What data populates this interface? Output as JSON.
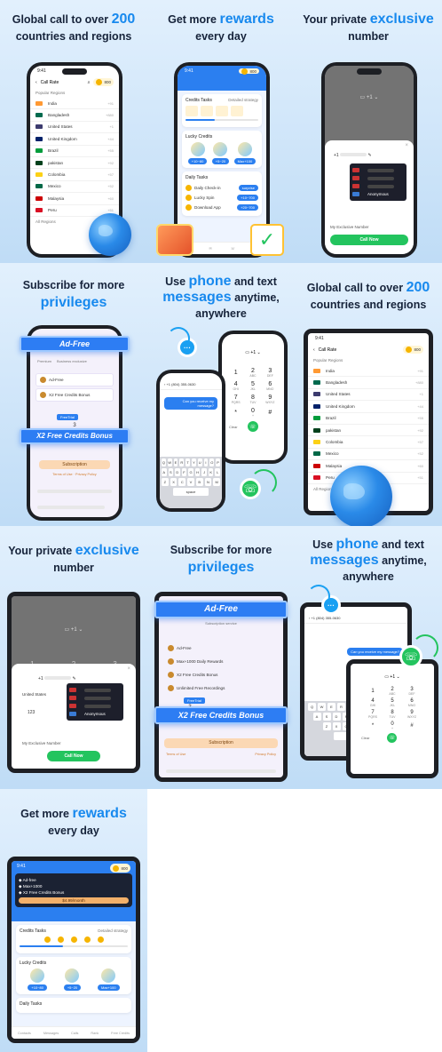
{
  "screens": [
    {
      "head_pre": "Global call to over ",
      "head_hl": "200",
      "head_post": "countries and regions"
    },
    {
      "head_pre": "Get more ",
      "head_hl": "rewards",
      "head_post": "every day"
    },
    {
      "head_pre": "Your private ",
      "head_hl": "exclusive",
      "head_post": "number"
    },
    {
      "head_pre": "Subscribe for more",
      "head_hl": "privileges",
      "head_post": ""
    },
    {
      "head_pre": "Use ",
      "head_hl": "phone",
      "head_mid": " and text",
      "head_hl2": "messages",
      "head_mid2": " anytime,",
      "head_post": "anywhere"
    },
    {
      "head_pre": "Global call to over ",
      "head_hl": "200",
      "head_post": "countries and regions"
    },
    {
      "head_pre": "Your private ",
      "head_hl": "exclusive",
      "head_post": "number"
    },
    {
      "head_pre": "Subscribe for more",
      "head_hl": "privileges",
      "head_post": ""
    },
    {
      "head_pre": "Use ",
      "head_hl": "phone",
      "head_mid": " and text",
      "head_hl2": "messages",
      "head_mid2": " anytime,",
      "head_post": "anywhere"
    },
    {
      "head_pre": "Get more ",
      "head_hl": "rewards",
      "head_post": "every day"
    }
  ],
  "status": {
    "time": "9:41",
    "credits": "800"
  },
  "call_rate": {
    "title": "Call Rate",
    "section": "Popular Regions",
    "all": "All Regions",
    "countries": [
      "India",
      "Bangladesh",
      "United States",
      "United Kingdom",
      "Brazil",
      "pakistan",
      "Colombia",
      "Mexico",
      "Malaysia",
      "Peru"
    ],
    "flags": [
      "#ff9933",
      "#006a4e",
      "#3c3b6e",
      "#012169",
      "#009c3b",
      "#01411c",
      "#fcd116",
      "#006847",
      "#cc0001",
      "#d91023"
    ],
    "rates": [
      "+91",
      "+880",
      "+1",
      "+44",
      "+55",
      "+92",
      "+57",
      "+52",
      "+60",
      "+51"
    ]
  },
  "rewards": {
    "credits_tasks": "Credits Tasks",
    "lucky_credits": "Lucky Credits",
    "daily_tasks": "Daily Tasks",
    "lucky": [
      "+10~80",
      "+5~20",
      "Max+100"
    ],
    "tasks": [
      "Daily Check-in",
      "Lucky Spin",
      "Download App"
    ],
    "task_btns": [
      "surprise",
      "+10~700",
      "+20~700"
    ],
    "rule": "Detailed strategy",
    "plan": [
      "Ad-free",
      "Max+1000",
      "X2 Free Credits Bonus"
    ],
    "price": "$4.99/month",
    "nav": [
      "Contacts",
      "Messages",
      "Calls",
      "Rank",
      "Free Credits"
    ]
  },
  "exclusive": {
    "code": "+1",
    "country": "United States",
    "label": "My Exclusive Number",
    "call": "Call Now",
    "anon": "Anonymous",
    "area": "123"
  },
  "subscribe": {
    "banner1": "Ad-Free",
    "banner2": "X2 Free Credits Bonus",
    "banner3": "Max+1000 Daily Rewards",
    "row1": "Ad-Free",
    "row2": "X2 Free Credits Bonus",
    "row3": "Max+1000 Daily Rewards",
    "row4": "Unlimited Free Recordings",
    "tab1": "Premium",
    "tab2": "Business exclusive",
    "trial": "FreeTrial",
    "num": "3",
    "btn": "Subscription",
    "terms": "Terms of Use",
    "privacy": "Privacy Policy",
    "sub_title": "Subscription service"
  },
  "messages": {
    "code": "+1",
    "msg_in": "Can you receive my message?",
    "msg_out": "Can you receive my message?",
    "number": "+1 (804) 355-0630",
    "keys": [
      "1",
      "2",
      "3",
      "4",
      "5",
      "6",
      "7",
      "8",
      "9",
      "*",
      "0",
      "#"
    ],
    "key_letters": [
      "",
      "ABC",
      "DEF",
      "GHI",
      "JKL",
      "MNO",
      "PQRS",
      "TUV",
      "WXYZ",
      "",
      "+",
      ""
    ],
    "kb1": [
      "Q",
      "W",
      "E",
      "R",
      "T",
      "Y",
      "U",
      "I",
      "O",
      "P"
    ],
    "kb2": [
      "A",
      "S",
      "D",
      "F",
      "G",
      "H",
      "J",
      "K",
      "L"
    ],
    "kb3": [
      "Z",
      "X",
      "C",
      "V",
      "B",
      "N",
      "M"
    ],
    "clear": "Clear",
    "space": "space",
    "sms": "SMS"
  }
}
